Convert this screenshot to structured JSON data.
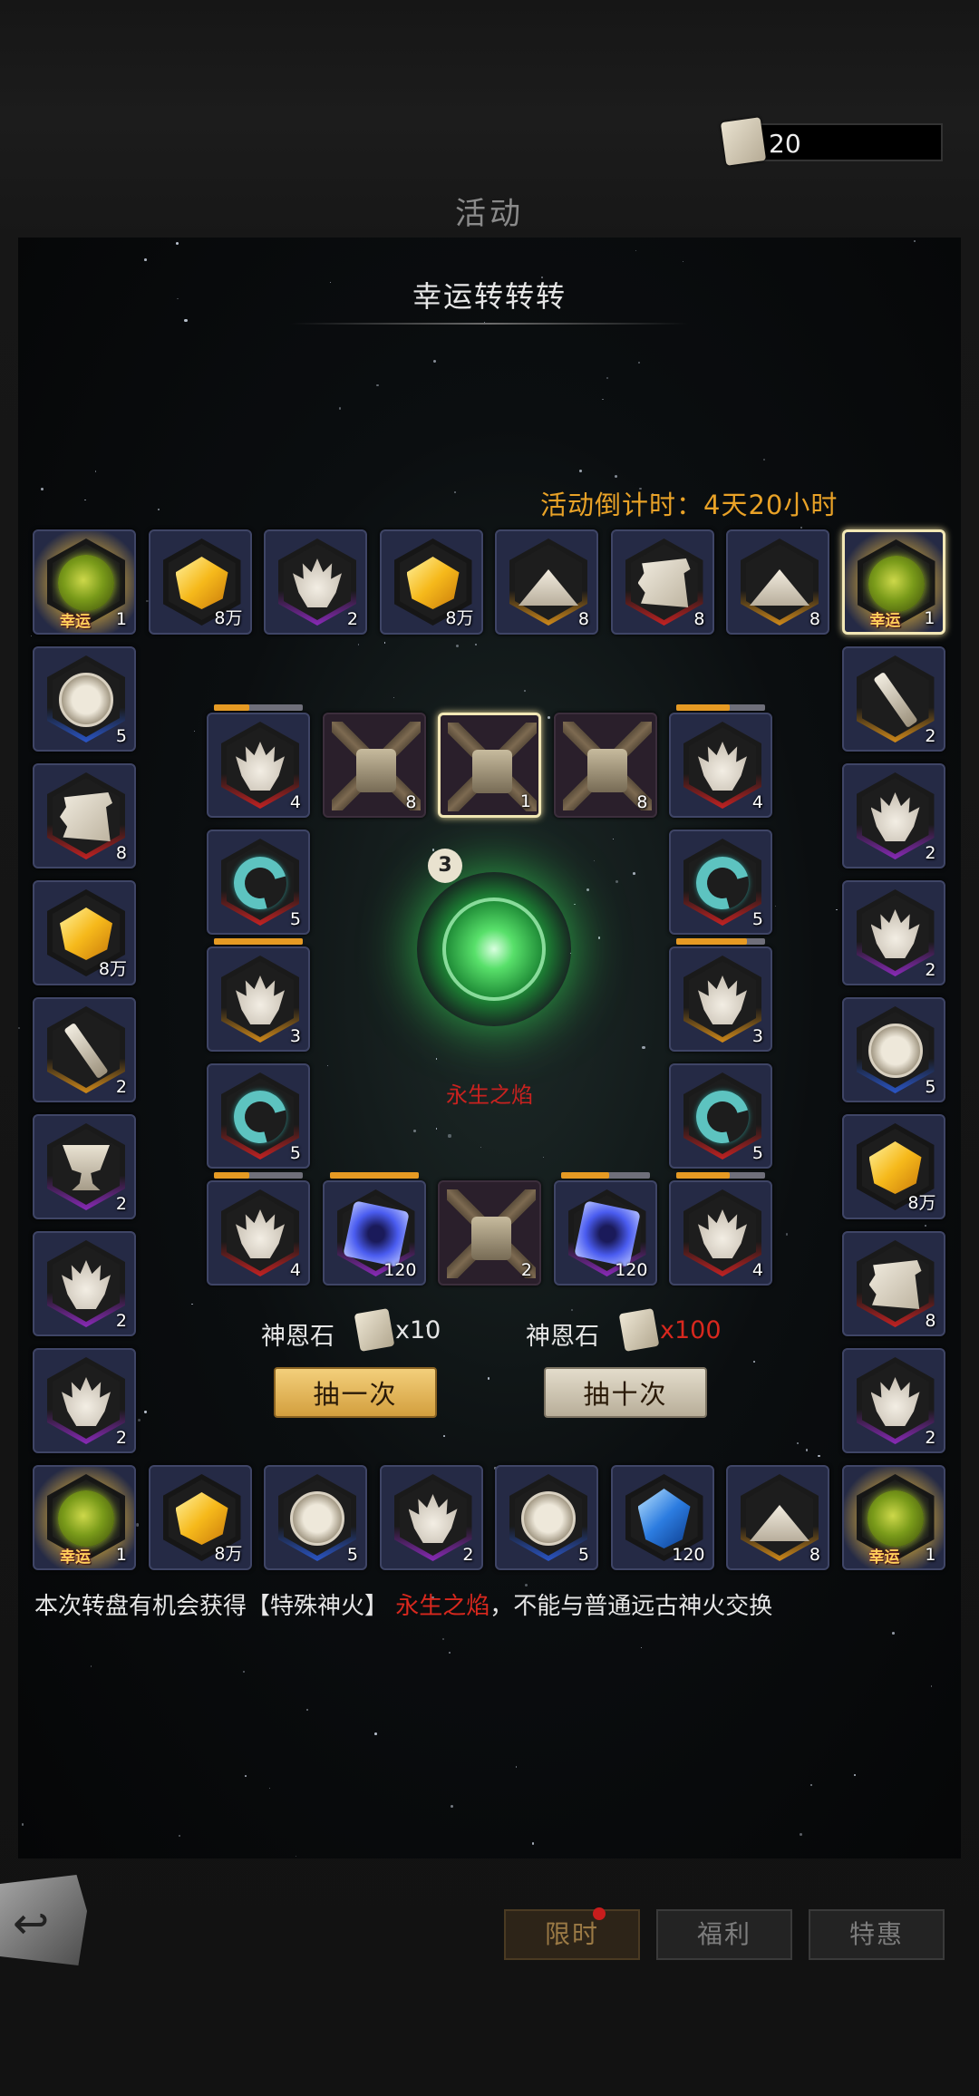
{
  "currency": {
    "amount": "20",
    "icon": "divine-grace-stone-icon"
  },
  "page_title": "活动",
  "panel": {
    "title": "幸运转转转",
    "countdown": "活动倒计时：4天20小时",
    "lucky_label": "幸运",
    "outer_ring": [
      {
        "item": "lucky-orb",
        "count": "1",
        "lucky": true
      },
      {
        "item": "gold-gem",
        "count": "8万"
      },
      {
        "item": "flame-purple",
        "count": "2"
      },
      {
        "item": "gold-gem",
        "count": "8万"
      },
      {
        "item": "sand-gold",
        "count": "8"
      },
      {
        "item": "scroll-red",
        "count": "8"
      },
      {
        "item": "sand-gold",
        "count": "8"
      },
      {
        "item": "lucky-orb",
        "count": "1",
        "lucky": true,
        "selected": true
      },
      {
        "item": "sword-gold",
        "count": "2"
      },
      {
        "item": "flame-purple",
        "count": "2"
      },
      {
        "item": "flame-purple",
        "count": "2"
      },
      {
        "item": "medal-blue",
        "count": "5"
      },
      {
        "item": "gold-gem",
        "count": "8万"
      },
      {
        "item": "scroll-red",
        "count": "8"
      },
      {
        "item": "flame-purple",
        "count": "2"
      },
      {
        "item": "lucky-orb",
        "count": "1",
        "lucky": true
      },
      {
        "item": "sand-gold",
        "count": "8"
      },
      {
        "item": "blue-gem",
        "count": "120"
      },
      {
        "item": "medal-blue",
        "count": "5"
      },
      {
        "item": "flame-purple",
        "count": "2"
      },
      {
        "item": "medal-blue",
        "count": "5"
      },
      {
        "item": "gold-gem",
        "count": "8万"
      },
      {
        "item": "lucky-orb",
        "count": "1",
        "lucky": true
      },
      {
        "item": "flame-purple",
        "count": "2"
      },
      {
        "item": "flame-purple",
        "count": "2"
      },
      {
        "item": "cup-purple",
        "count": "2"
      },
      {
        "item": "sword-gold",
        "count": "2"
      },
      {
        "item": "gold-gem",
        "count": "8万"
      },
      {
        "item": "scroll-red",
        "count": "8"
      },
      {
        "item": "medal-blue",
        "count": "5"
      }
    ],
    "inner_ring": [
      {
        "item": "flame-red",
        "count": "4",
        "progress": 0.4
      },
      {
        "item": "locked",
        "count": "8"
      },
      {
        "item": "locked",
        "count": "1",
        "selected": true
      },
      {
        "item": "locked",
        "count": "8"
      },
      {
        "item": "flame-red",
        "count": "4",
        "progress": 0.6
      },
      {
        "item": "ring-red",
        "count": "5"
      },
      {
        "item": "flame-gold",
        "count": "3",
        "progress": 0.8
      },
      {
        "item": "ring-red",
        "count": "5"
      },
      {
        "item": "flame-red",
        "count": "4",
        "progress": 0.6
      },
      {
        "item": "cube-purple",
        "count": "120",
        "progress": 0.55
      },
      {
        "item": "locked",
        "count": "2"
      },
      {
        "item": "cube-purple",
        "count": "120",
        "progress": 1.0
      },
      {
        "item": "flame-red",
        "count": "4",
        "progress": 0.4
      },
      {
        "item": "ring-red",
        "count": "5"
      },
      {
        "item": "flame-gold",
        "count": "3",
        "progress": 1.0
      },
      {
        "item": "ring-red",
        "count": "5"
      }
    ],
    "center": {
      "number": "3",
      "name": "永生之焰"
    },
    "cost_one": {
      "label": "神恩石",
      "amount": "x10"
    },
    "cost_ten": {
      "label": "神恩石",
      "amount": "x100",
      "amount_color": "#d8281e"
    },
    "draw_one": "抽一次",
    "draw_ten": "抽十次",
    "description_prefix": "本次转盘有机会获得【特殊神火】",
    "description_highlight": "永生之焰",
    "description_suffix": "，不能与普通远古神火交换"
  },
  "nav": {
    "back_icon": "back-arrow-icon",
    "tab_limited": "限时",
    "tab_welfare": "福利",
    "tab_deal": "特惠"
  },
  "colors": {
    "accent_gold": "#e9a227",
    "highlight_red": "#c8221f"
  }
}
